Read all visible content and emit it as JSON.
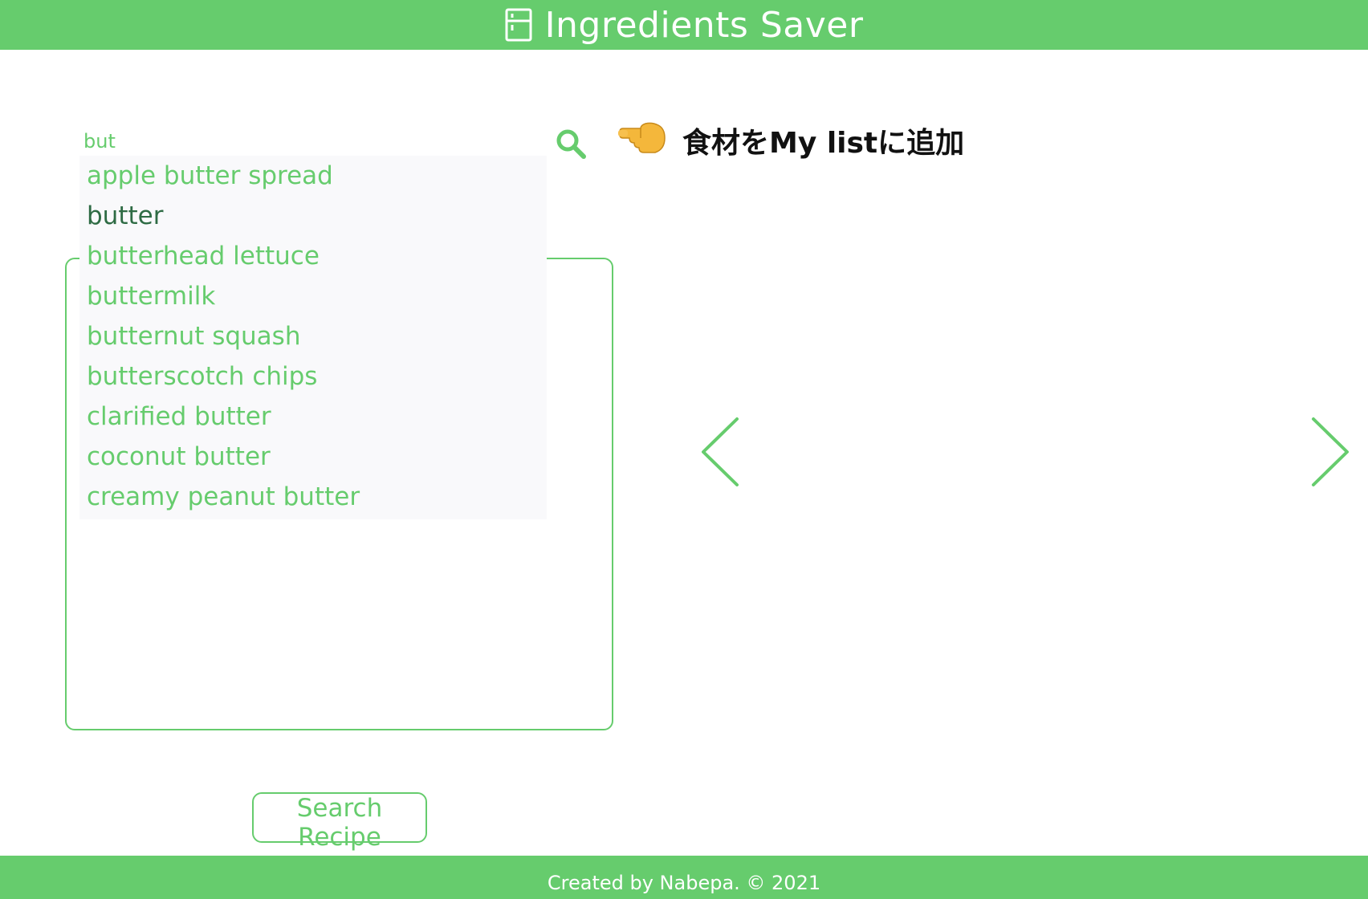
{
  "header": {
    "title": "Ingredients Saver",
    "icon": "fridge-icon"
  },
  "search": {
    "value": "but",
    "icon": "search-icon"
  },
  "add_hint": {
    "emoji": "👈",
    "text": "食材をMy listに追加"
  },
  "dropdown": {
    "items": [
      "apple butter spread",
      "butter",
      "butterhead lettuce",
      "buttermilk",
      "butternut squash",
      "butterscotch chips",
      "clarified butter",
      "coconut butter",
      "creamy peanut butter"
    ],
    "active_index": 1
  },
  "carousel": {
    "prev_icon": "chevron-left-icon",
    "next_icon": "chevron-right-icon"
  },
  "search_recipe": {
    "label": "Search Recipe"
  },
  "footer": {
    "text": "Created by Nabepa. © 2021"
  },
  "colors": {
    "accent": "#66cc6d",
    "active_item": "#2e6b44",
    "dropdown_bg": "#f9f9fb"
  }
}
